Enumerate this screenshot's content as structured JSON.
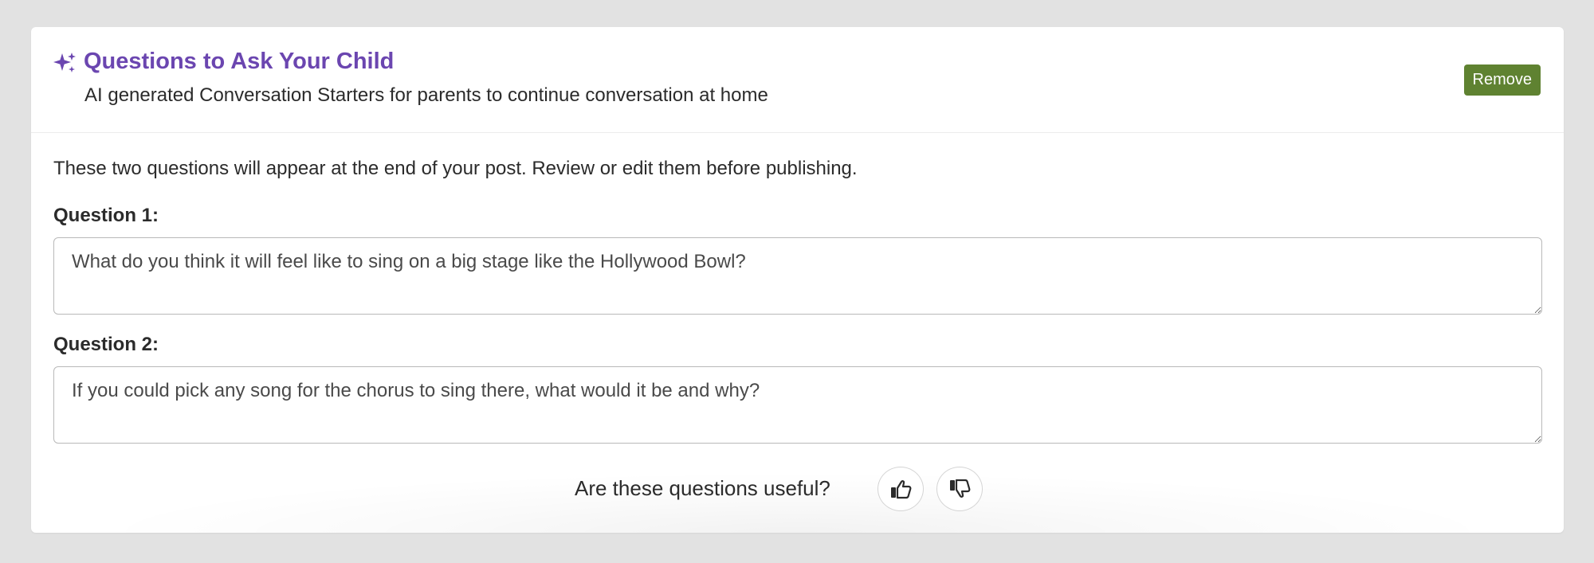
{
  "header": {
    "title": "Questions to Ask Your Child",
    "subtitle": "AI generated Conversation Starters for parents to continue conversation at home",
    "title_icon": "sparkle-icon",
    "remove_label": "Remove"
  },
  "intro": "These two questions will appear at the end of your post. Review or edit them before publishing.",
  "questions": [
    {
      "label": "Question 1:",
      "value": "What do you think it will feel like to sing on a big stage like the Hollywood Bowl?"
    },
    {
      "label": "Question 2:",
      "value": "If you could pick any song for the chorus to sing there, what would it be and why?"
    }
  ],
  "feedback": {
    "label": "Are these questions useful?",
    "thumbs_up_icon": "thumbs-up-icon",
    "thumbs_down_icon": "thumbs-down-icon"
  },
  "colors": {
    "accent": "#6b46b0",
    "remove_button": "#5f8231",
    "page_background": "#e2e2e2"
  }
}
